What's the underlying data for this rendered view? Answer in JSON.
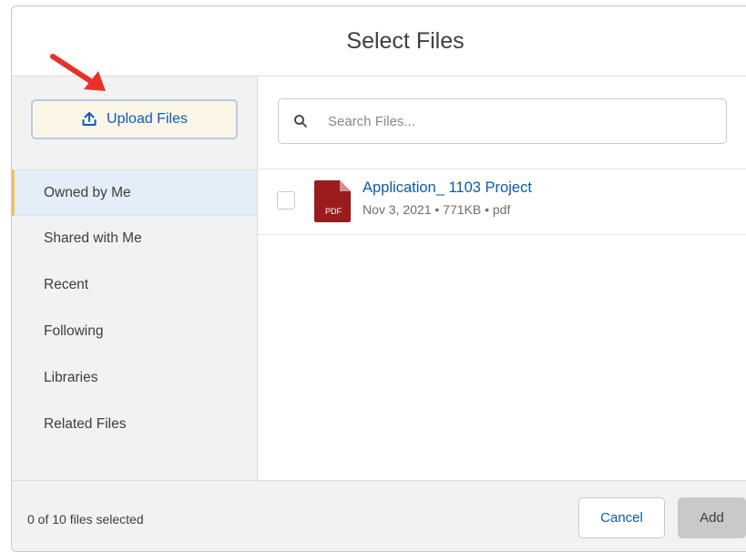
{
  "dialog": {
    "title": "Select Files"
  },
  "sidebar": {
    "upload_label": "Upload Files",
    "upload_icon": "upload-icon",
    "items": [
      {
        "label": "Owned by Me",
        "active": true
      },
      {
        "label": "Shared with Me",
        "active": false
      },
      {
        "label": "Recent",
        "active": false
      },
      {
        "label": "Following",
        "active": false
      },
      {
        "label": "Libraries",
        "active": false
      },
      {
        "label": "Related Files",
        "active": false
      }
    ]
  },
  "search": {
    "placeholder": "Search Files...",
    "value": "",
    "icon": "search-icon"
  },
  "files": [
    {
      "name": "Application_ 1103 Project",
      "meta": "Nov 3, 2021 • 771KB • pdf",
      "icon": "pdf-icon",
      "icon_badge": "PDF",
      "checked": false
    }
  ],
  "footer": {
    "status": "0 of 10 files selected",
    "cancel_label": "Cancel",
    "add_label": "Add"
  },
  "colors": {
    "accent": "#0b5cab",
    "annotation_arrow": "#e8312b",
    "pdf_icon": "#9b1c1c",
    "active_nav_bg": "#e4eef9"
  }
}
